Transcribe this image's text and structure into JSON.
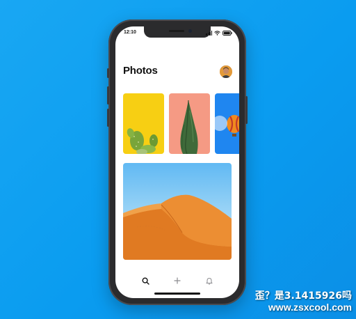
{
  "status_bar": {
    "time": "12:10"
  },
  "header": {
    "title": "Photos",
    "avatar_icon": "profile-avatar"
  },
  "thumbnails": [
    {
      "subject": "cactus",
      "background": "#f7cf13"
    },
    {
      "subject": "cypress-tree",
      "background": "#f59a84"
    },
    {
      "subject": "hot-air-balloon",
      "background": "#1f86f0"
    }
  ],
  "featured_photo": {
    "subject": "desert-sand-dune",
    "sky": "#61b9f3",
    "sand": "#e8842c"
  },
  "tab_bar": {
    "items": [
      {
        "icon": "search-icon"
      },
      {
        "icon": "plus-icon"
      },
      {
        "icon": "bell-icon"
      }
    ]
  },
  "watermark": {
    "line1": "歪？是3.1415926吗",
    "line2": "www.zsxcool.com"
  },
  "colors": {
    "background": "#0a9cf0",
    "phone_frame": "#2b2b2d",
    "screen": "#ffffff"
  }
}
